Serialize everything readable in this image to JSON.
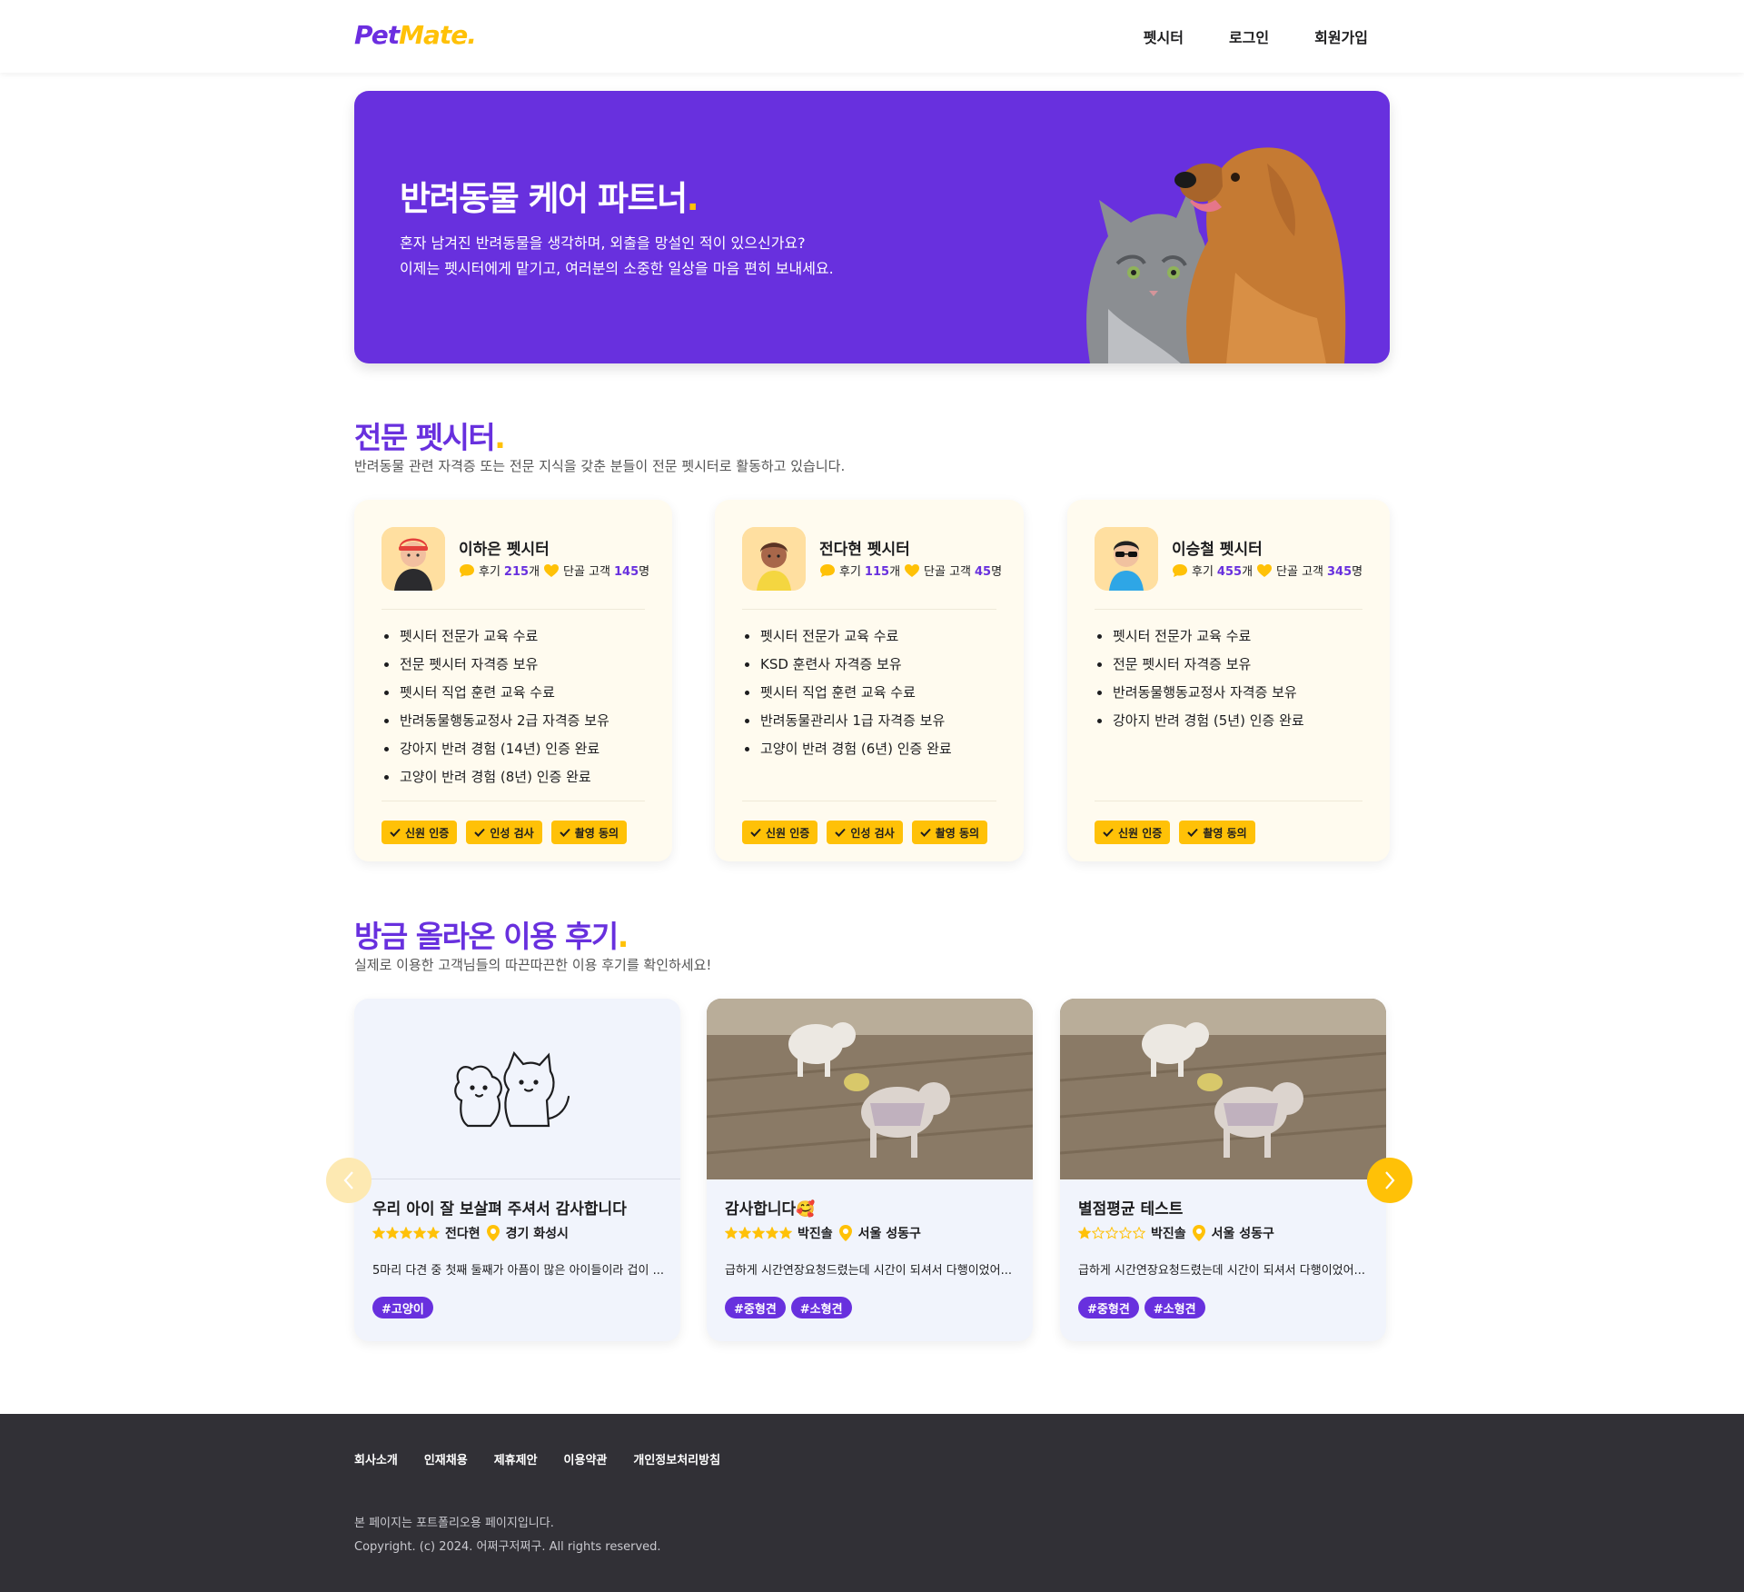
{
  "header": {
    "logo_part1": "Pet",
    "logo_part2": "Mate.",
    "nav": [
      "펫시터",
      "로그인",
      "회원가입"
    ]
  },
  "hero": {
    "title": "반려동물 케어 파트너",
    "title_dot": ".",
    "line1": "혼자 남겨진 반려동물을 생각하며, 외출을 망설인 적이 있으신가요?",
    "line2": "이제는 펫시터에게 맡기고, 여러분의 소중한 일상을 마음 편히 보내세요."
  },
  "sitters_section": {
    "title": "전문 펫시터",
    "title_dot": ".",
    "subtitle": "반려동물 관련 자격증 또는 전문 지식을 갖춘 분들이 전문 펫시터로 활동하고 있습니다."
  },
  "sitters": [
    {
      "name": "이하은 펫시터",
      "review_label": "후기",
      "review_count": "215",
      "review_unit": "개",
      "regular_label": "단골 고객",
      "regular_count": "145",
      "regular_unit": "명",
      "credentials": [
        "펫시터 전문가 교육 수료",
        "전문 펫시터 자격증 보유",
        "펫시터 직업 훈련 교육 수료",
        "반려동물행동교정사 2급 자격증 보유",
        "강아지 반려 경험 (14년) 인증 완료",
        "고양이 반려 경험 (8년) 인증 완료"
      ],
      "badges": [
        "신원 인증",
        "인성 검사",
        "촬영 동의"
      ]
    },
    {
      "name": "전다현 펫시터",
      "review_label": "후기",
      "review_count": "115",
      "review_unit": "개",
      "regular_label": "단골 고객",
      "regular_count": "45",
      "regular_unit": "명",
      "credentials": [
        "펫시터 전문가 교육 수료",
        "KSD 훈련사 자격증 보유",
        "펫시터 직업 훈련 교육 수료",
        "반려동물관리사 1급 자격증 보유",
        "고양이 반려 경험 (6년) 인증 완료"
      ],
      "badges": [
        "신원 인증",
        "인성 검사",
        "촬영 동의"
      ]
    },
    {
      "name": "이승철 펫시터",
      "review_label": "후기",
      "review_count": "455",
      "review_unit": "개",
      "regular_label": "단골 고객",
      "regular_count": "345",
      "regular_unit": "명",
      "credentials": [
        "펫시터 전문가 교육 수료",
        "전문 펫시터 자격증 보유",
        "반려동물행동교정사 자격증 보유",
        "강아지 반려 경험 (5년) 인증 완료"
      ],
      "badges": [
        "신원 인증",
        "촬영 동의"
      ]
    }
  ],
  "reviews_section": {
    "title": "방금 올라온 이용 후기",
    "title_dot": ".",
    "subtitle": "실제로 이용한 고객님들의 따끈따끈한 이용 후기를 확인하세요!"
  },
  "reviews": [
    {
      "title": "우리 아이 잘 보살펴 주셔서 감사합니다",
      "rating": 5,
      "sitter": "전다현",
      "location": "경기 화성시",
      "text": "5마리 다견 중 첫째 둘째가 아픔이 많은 아이들이라 겁이 ...",
      "tags": [
        "#고양이"
      ],
      "image": "placeholder-illustration"
    },
    {
      "title": "감사합니다🥰",
      "rating": 5,
      "sitter": "박진솔",
      "location": "서울 성동구",
      "text": "급하게 시간연장요청드렸는데 시간이 되셔서 다행이었어...",
      "tags": [
        "#중형견",
        "#소형견"
      ],
      "image": "dogs-photo"
    },
    {
      "title": "별점평균 테스트",
      "rating": 1,
      "sitter": "박진솔",
      "location": "서울 성동구",
      "text": "급하게 시간연장요청드렸는데 시간이 되셔서 다행이었어...",
      "tags": [
        "#중형견",
        "#소형견"
      ],
      "image": "dogs-photo"
    }
  ],
  "footer": {
    "links": [
      "회사소개",
      "인재채용",
      "제휴제안",
      "이용약관",
      "개인정보처리방침"
    ],
    "note1": "본 페이지는 포트폴리오용 페이지입니다.",
    "note2": "Copyright. (c) 2024. 어쩌구저쩌구. All rights reserved."
  },
  "colors": {
    "brand_purple": "#6830de",
    "brand_yellow": "#ffc107",
    "footer_bg": "#313036"
  }
}
